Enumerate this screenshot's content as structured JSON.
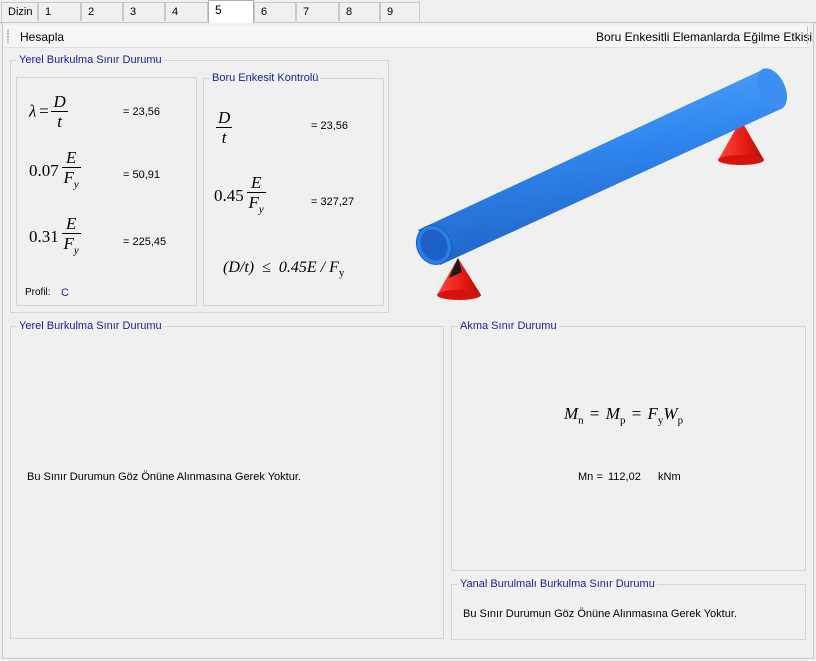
{
  "tabs": [
    {
      "label": "Dizin"
    },
    {
      "label": "1"
    },
    {
      "label": "2"
    },
    {
      "label": "3"
    },
    {
      "label": "4"
    },
    {
      "label": "5"
    },
    {
      "label": "6"
    },
    {
      "label": "7"
    },
    {
      "label": "8"
    },
    {
      "label": "9"
    }
  ],
  "active_tab": "5",
  "toolbar": {
    "left_label": "Hesapla",
    "right_title": "Boru Enkesitli Elemanlarda Eğilme Etkisi"
  },
  "local_buckling": {
    "legend": "Yerel Burkulma Sınır Durumu",
    "lambda_value": "= 23,56",
    "coef1": "0.07",
    "limit1_value": "= 50,91",
    "coef2": "0.31",
    "limit2_value": "= 225,45",
    "profile_label": "Profil:",
    "profile_value": "C"
  },
  "pipe_check": {
    "legend": "Boru Enkesit Kontrolü",
    "dt_value": "= 23,56",
    "coef": "0.45",
    "limit_value": "= 327,27",
    "condition_left": "(D/t)",
    "condition_op": "≤",
    "condition_right": "0.45E / F",
    "condition_sub": "y"
  },
  "lower_local": {
    "legend": "Yerel Burkulma Sınır Durumu",
    "message": "Bu Sınır Durumun Göz Önüne Alınmasına Gerek Yoktur."
  },
  "yield": {
    "legend": "Akma Sınır Durumu",
    "result_label": "Mn =",
    "result_value": "112,02",
    "result_unit": "kNm"
  },
  "ltb": {
    "legend": "Yanal Burulmalı Burkulma Sınır Durumu",
    "message": "Bu Sınır Durumun Göz Önüne Alınmasına Gerek Yoktur."
  },
  "symbols": {
    "lambda": "λ",
    "D": "D",
    "t": "t",
    "E": "E",
    "F": "F",
    "y": "y",
    "M": "M",
    "n": "n",
    "p": "p",
    "W": "W"
  },
  "colors": {
    "pipe": "#3a8ef0",
    "support": "#e8201a",
    "legend": "#1a1aa6"
  }
}
